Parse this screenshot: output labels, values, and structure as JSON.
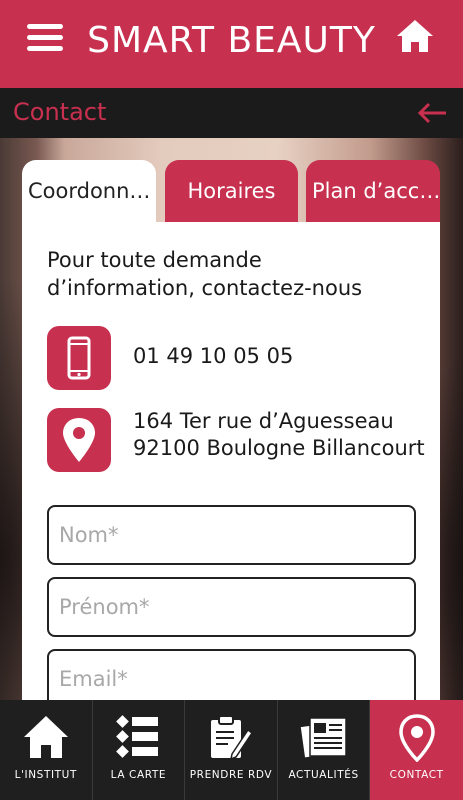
{
  "header": {
    "title": "SMART BEAUTY",
    "menu_icon": "hamburger-menu-icon",
    "home_icon": "home-icon"
  },
  "subheader": {
    "title": "Contact",
    "back_icon": "back-arrow-icon"
  },
  "tabs": [
    {
      "label": "Coordonn…",
      "active": true
    },
    {
      "label": "Horaires",
      "active": false
    },
    {
      "label": "Plan d’acc…",
      "active": false
    }
  ],
  "contact": {
    "intro": "Pour toute demande d’information, contactez-nous",
    "phone": "01 49 10 05 05",
    "address_line1": "164 Ter rue d’Aguesseau",
    "address_line2": "92100 Boulogne Billancourt",
    "phone_icon": "smartphone-icon",
    "address_icon": "map-pin-icon"
  },
  "form": {
    "nom_placeholder": "Nom*",
    "prenom_placeholder": "Prénom*",
    "email_placeholder": "Email*"
  },
  "nav": [
    {
      "label": "L'INSTITUT",
      "icon": "home-icon",
      "active": false
    },
    {
      "label": "LA CARTE",
      "icon": "list-icon",
      "active": false
    },
    {
      "label": "PRENDRE RDV",
      "icon": "clipboard-pen-icon",
      "active": false
    },
    {
      "label": "ACTUALITÉS",
      "icon": "newspaper-icon",
      "active": false
    },
    {
      "label": "CONTACT",
      "icon": "map-pin-icon",
      "active": true
    }
  ],
  "colors": {
    "accent": "#c8304f",
    "dark": "#1b1b1b",
    "white": "#ffffff"
  }
}
